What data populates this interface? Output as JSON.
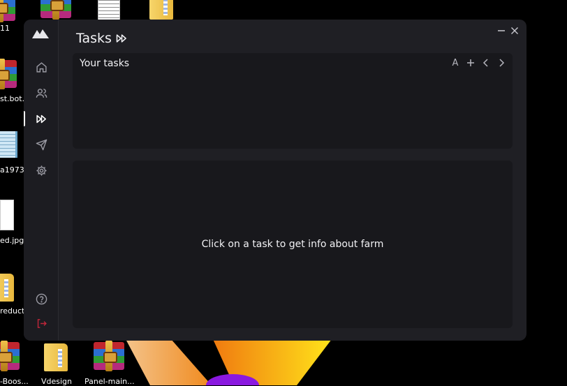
{
  "desktop": {
    "icons": [
      {
        "label": "11"
      },
      {
        "label": "st.bot..."
      },
      {
        "label": "a1973..."
      },
      {
        "label": "ed.jpg"
      },
      {
        "label": "reduct"
      },
      {
        "label": "-Boos..."
      },
      {
        "label": "Vdesign"
      },
      {
        "label": "Panel-main..."
      }
    ]
  },
  "window": {
    "title": "Tasks",
    "controls": {
      "minimize": "minimize-icon",
      "close": "close-icon"
    }
  },
  "sidebar": {
    "items": [
      {
        "name": "home",
        "icon": "home-icon"
      },
      {
        "name": "accounts",
        "icon": "users-icon"
      },
      {
        "name": "tasks",
        "icon": "fast-forward-icon",
        "active": true
      },
      {
        "name": "send",
        "icon": "send-icon"
      },
      {
        "name": "settings",
        "icon": "gear-icon"
      }
    ],
    "bottom": [
      {
        "name": "help",
        "icon": "help-circle-icon"
      },
      {
        "name": "logout",
        "icon": "logout-icon",
        "color": "#c0263a"
      }
    ]
  },
  "tasks_panel": {
    "title": "Your tasks",
    "tools": {
      "sort_label": "A"
    }
  },
  "info_panel": {
    "message": "Click on a task to get info about farm"
  },
  "colors": {
    "window_bg": "#1f1f24",
    "panel_bg": "#18181c",
    "text": "#f2f2f5",
    "icon": "#b5b5bd",
    "logout": "#c0263a"
  }
}
